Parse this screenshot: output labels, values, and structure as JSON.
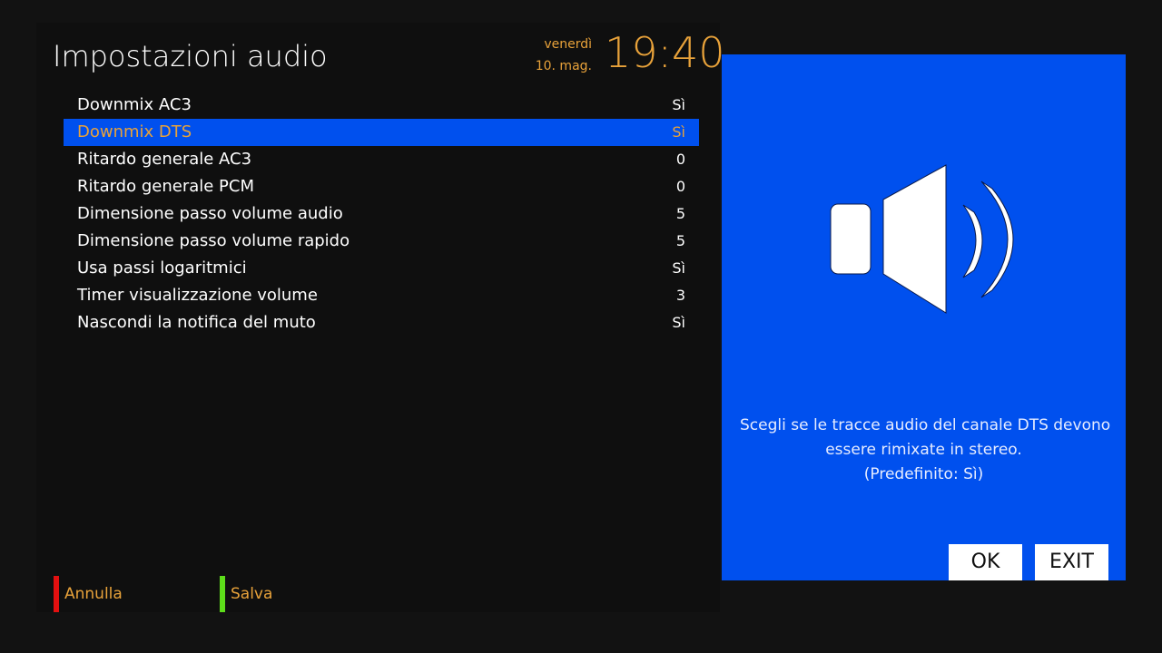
{
  "header": {
    "title": "Impostazioni audio",
    "day": "venerdì",
    "date": "10. mag.",
    "time": "19:40"
  },
  "settings": [
    {
      "label": "Downmix AC3",
      "value": "Sì",
      "selected": false
    },
    {
      "label": "Downmix DTS",
      "value": "Sì",
      "selected": true
    },
    {
      "label": "Ritardo generale AC3",
      "value": "0",
      "selected": false
    },
    {
      "label": "Ritardo generale PCM",
      "value": "0",
      "selected": false
    },
    {
      "label": "Dimensione passo volume audio",
      "value": "5",
      "selected": false
    },
    {
      "label": "Dimensione passo volume rapido",
      "value": "5",
      "selected": false
    },
    {
      "label": "Usa passi logaritmici",
      "value": "Sì",
      "selected": false
    },
    {
      "label": "Timer visualizzazione volume",
      "value": "3",
      "selected": false
    },
    {
      "label": "Nascondi la notifica del muto",
      "value": "Sì",
      "selected": false
    }
  ],
  "footer": {
    "red_label": "Annulla",
    "green_label": "Salva"
  },
  "info": {
    "icon": "speaker-volume-icon",
    "description_line1": "Scegli se le tracce audio del canale DTS devono",
    "description_line2": "essere rimixate in stereo.",
    "description_line3": "(Predefinito: Sì)",
    "ok_label": "OK",
    "exit_label": "EXIT"
  },
  "colors": {
    "accent": "#e8a23a",
    "highlight": "#0050ee",
    "red_key": "#e31010",
    "green_key": "#5ddd1a"
  }
}
